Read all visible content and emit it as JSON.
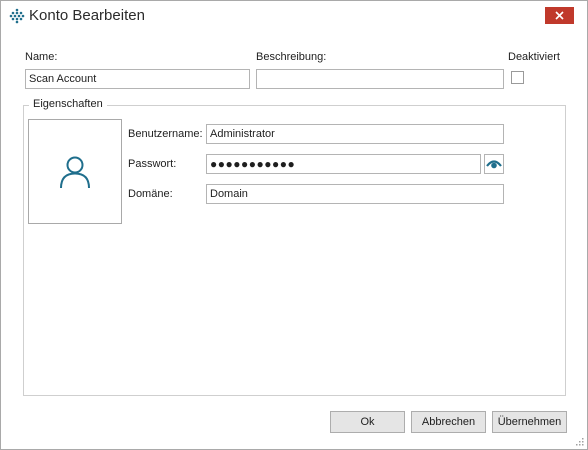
{
  "window": {
    "title": "Konto Bearbeiten",
    "close_icon": "close-x-icon",
    "app_icon": "dot-grid-icon"
  },
  "form": {
    "name_label": "Name:",
    "name_value": "Scan Account",
    "description_label": "Beschreibung:",
    "description_value": "",
    "disabled_label": "Deaktiviert",
    "disabled_checked": false
  },
  "properties": {
    "group_label": "Eigenschaften",
    "avatar_icon": "user-icon",
    "username_label": "Benutzername:",
    "username_value": "Administrator",
    "password_label": "Passwort:",
    "password_masked": "●●●●●●●●●●●",
    "show_password_icon": "eye-icon",
    "domain_label": "Domäne:",
    "domain_value": "Domain"
  },
  "buttons": {
    "ok": "Ok",
    "cancel": "Abbrechen",
    "apply": "Übernehmen"
  },
  "colors": {
    "accent": "#1f6e8c",
    "close": "#c0392b"
  }
}
